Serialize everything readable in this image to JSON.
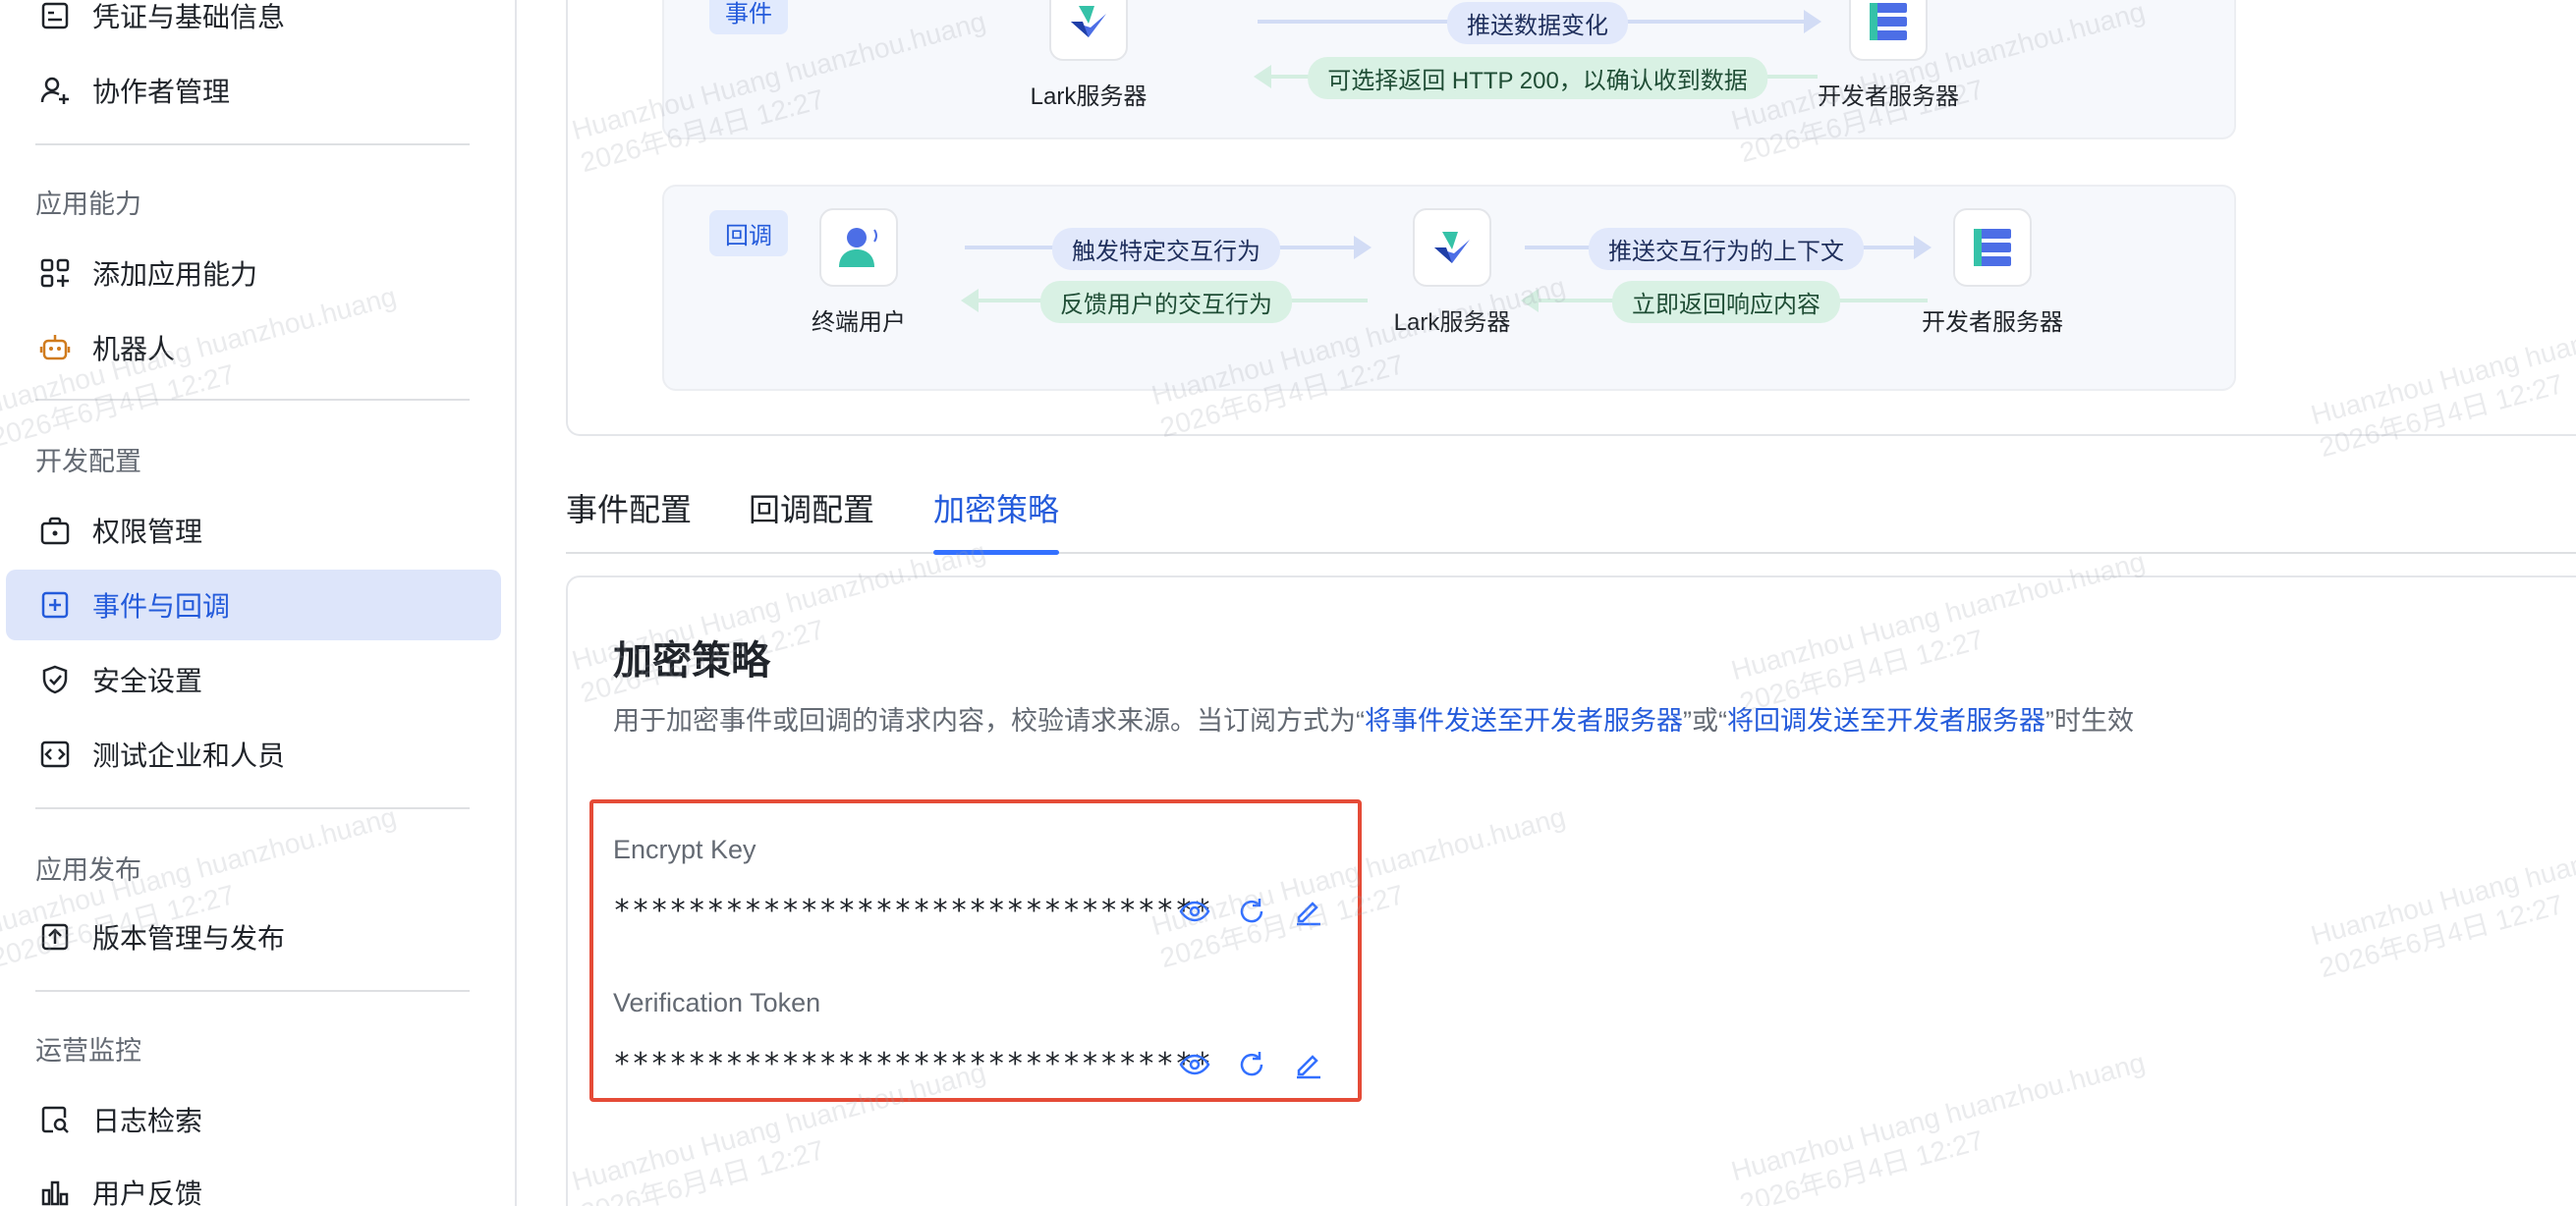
{
  "sidebar": {
    "items": [
      {
        "label": "凭证与基础信息"
      },
      {
        "label": "协作者管理"
      },
      {
        "label": "添加应用能力"
      },
      {
        "label": "机器人"
      },
      {
        "label": "权限管理"
      },
      {
        "label": "事件与回调"
      },
      {
        "label": "安全设置"
      },
      {
        "label": "测试企业和人员"
      },
      {
        "label": "版本管理与发布"
      },
      {
        "label": "日志检索"
      },
      {
        "label": "用户反馈"
      }
    ],
    "groups": {
      "app_capability": "应用能力",
      "dev_config": "开发配置",
      "app_release": "应用发布",
      "ops_monitor": "运营监控"
    }
  },
  "flow": {
    "event": {
      "tag": "事件",
      "lark_server": "Lark服务器",
      "dev_server": "开发者服务器",
      "push_label": "推送数据变化",
      "return_label": "可选择返回 HTTP 200，以确认收到数据"
    },
    "callback": {
      "tag": "回调",
      "end_user": "终端用户",
      "lark_server": "Lark服务器",
      "dev_server": "开发者服务器",
      "trigger_label": "触发特定交互行为",
      "feedback_label": "反馈用户的交互行为",
      "push_context_label": "推送交互行为的上下文",
      "respond_label": "立即返回响应内容"
    }
  },
  "tabs": [
    {
      "label": "事件配置"
    },
    {
      "label": "回调配置"
    },
    {
      "label": "加密策略"
    }
  ],
  "encryption": {
    "title": "加密策略",
    "desc_prefix": "用于加密事件或回调的请求内容，校验请求来源。当订阅方式为“",
    "desc_link1": "将事件发送至开发者服务器",
    "desc_mid": "”或“",
    "desc_link2": "将回调发送至开发者服务器",
    "desc_suffix": "”时生效",
    "encrypt_key_label": "Encrypt Key",
    "encrypt_key_value": "********************************",
    "verification_token_label": "Verification Token",
    "verification_token_value": "********************************"
  },
  "watermark": {
    "line1": "Huanzhou Huang huanzhou.huang",
    "line2": "2026年6月4日 12:27"
  },
  "colors": {
    "accent": "#245bdb",
    "active_bg": "#dde5fa",
    "highlight_border": "#e54b37"
  },
  "icons": [
    "credential-icon",
    "add-collaborator-icon",
    "app-capability-icon",
    "robot-icon",
    "permission-icon",
    "event-callback-icon",
    "security-icon",
    "test-company-icon",
    "release-icon",
    "log-search-icon",
    "feedback-icon",
    "eye-icon",
    "refresh-icon",
    "edit-icon"
  ]
}
